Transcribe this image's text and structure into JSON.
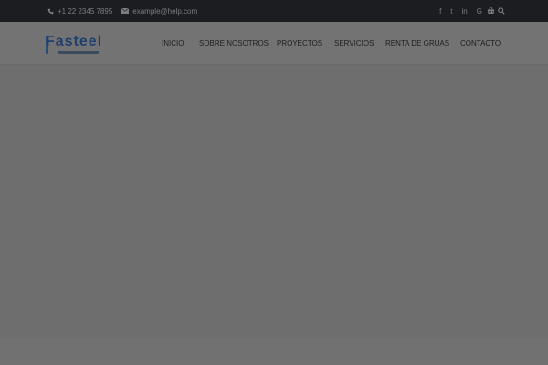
{
  "topbar": {
    "phone": "+1 22 2345 7895",
    "email": "example@help.com",
    "social": [
      {
        "icon": "facebook-icon",
        "glyph": "f"
      },
      {
        "icon": "twitter-icon",
        "glyph": "t"
      },
      {
        "icon": "linkedin-icon",
        "glyph": "in"
      },
      {
        "icon": "google-icon",
        "glyph": "G"
      }
    ]
  },
  "header": {
    "logo_text": "Fasteel"
  },
  "nav": {
    "items": [
      {
        "label": "INICIO"
      },
      {
        "label": "SOBRE NOSOTROS"
      },
      {
        "label": "PROYECTOS"
      },
      {
        "label": "SERVICIOS"
      },
      {
        "label": "RENTA DE GRUAS"
      },
      {
        "label": "CONTACTO"
      }
    ]
  },
  "colors": {
    "topbar_bg": "#1c1d21",
    "overlay_bg": "#6e6e6e",
    "nav_text": "#1e1e1e",
    "logo_blue": "#1f3f6e"
  }
}
